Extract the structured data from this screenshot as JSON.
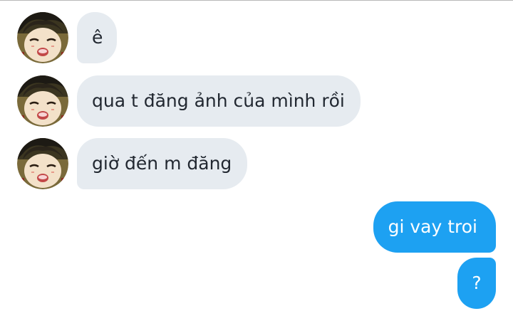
{
  "colors": {
    "incoming_bubble": "#e6ebf0",
    "outgoing_bubble": "#1da1f2"
  },
  "conversation": {
    "messages": [
      {
        "direction": "incoming",
        "text": "ê"
      },
      {
        "direction": "incoming",
        "text": "qua t đăng ảnh của mình rồi"
      },
      {
        "direction": "incoming",
        "text": "giờ đến m đăng"
      },
      {
        "direction": "outgoing",
        "text": "gi vay troi"
      },
      {
        "direction": "outgoing",
        "text": "?"
      }
    ]
  },
  "icons": {
    "avatar": "anime-character-avatar-icon"
  }
}
